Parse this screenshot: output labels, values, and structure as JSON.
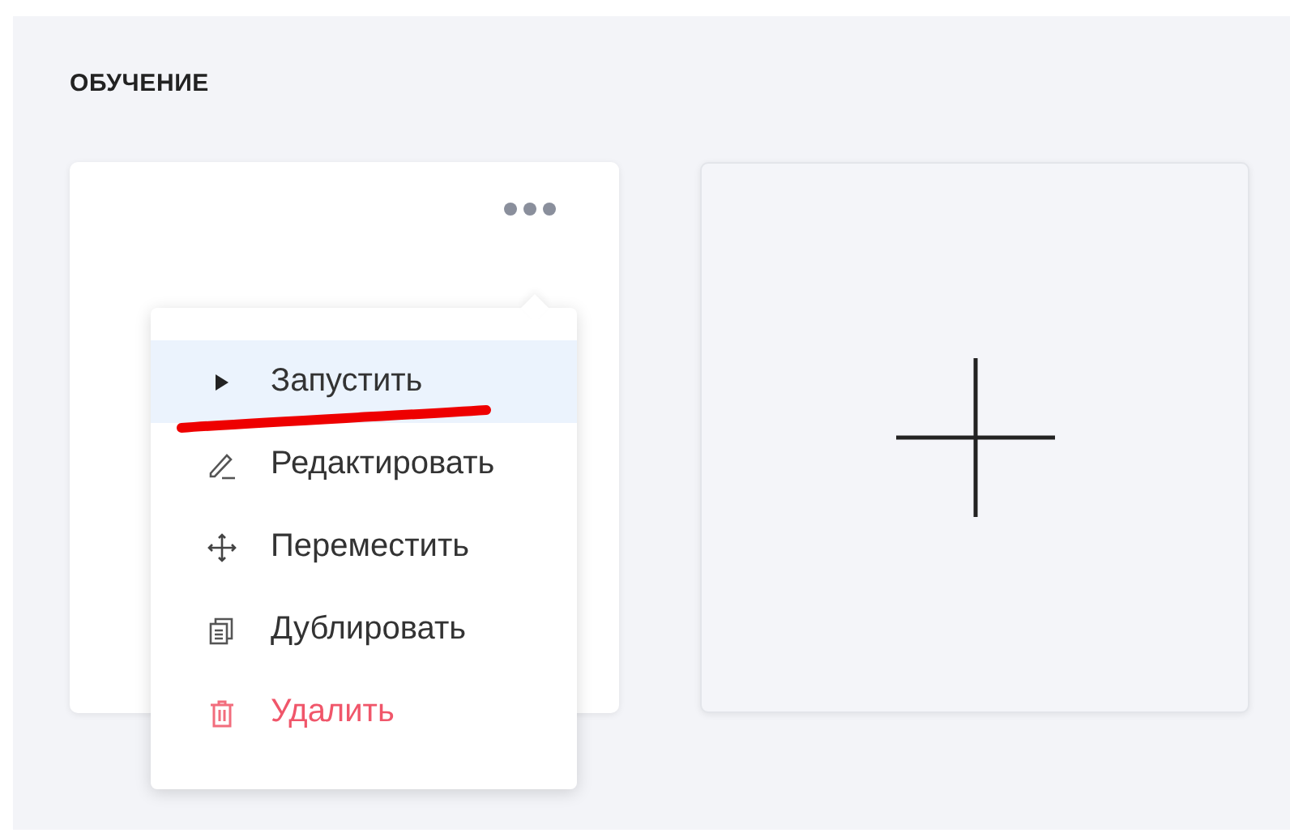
{
  "section": {
    "title": "ОБУЧЕНИЕ"
  },
  "menu": {
    "items": [
      {
        "kind": "play",
        "label": "Запустить",
        "selected": true,
        "underlined": true
      },
      {
        "kind": "edit",
        "label": "Редактировать",
        "selected": false,
        "underlined": false
      },
      {
        "kind": "move",
        "label": "Переместить",
        "selected": false,
        "underlined": false
      },
      {
        "kind": "duplicate",
        "label": "Дублировать",
        "selected": false,
        "underlined": false
      },
      {
        "kind": "delete",
        "label": "Удалить",
        "selected": false,
        "underlined": false
      }
    ]
  }
}
